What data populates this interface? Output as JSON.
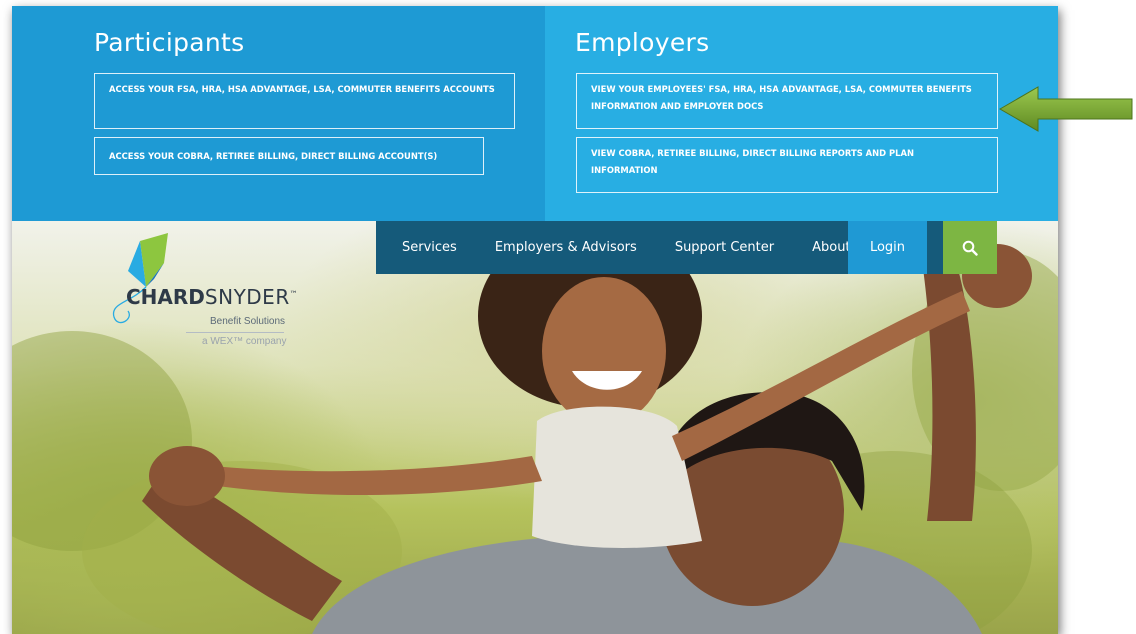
{
  "participants": {
    "title": "Participants",
    "links": [
      "ACCESS YOUR FSA, HRA, HSA ADVANTAGE, LSA, COMMUTER BENEFITS ACCOUNTS",
      "ACCESS YOUR COBRA, RETIREE BILLING, DIRECT BILLING ACCOUNT(S)"
    ]
  },
  "employers": {
    "title": "Employers",
    "links": [
      "VIEW YOUR EMPLOYEES' FSA, HRA, HSA ADVANTAGE, LSA, COMMUTER BENEFITS INFORMATION AND EMPLOYER DOCS",
      "VIEW COBRA, RETIREE BILLING, DIRECT BILLING REPORTS AND PLAN INFORMATION"
    ]
  },
  "logo": {
    "brand_bold": "CHARD",
    "brand_light": "SNYDER",
    "trademark": "™",
    "tagline": "Benefit Solutions",
    "company": "a WEX™ company"
  },
  "nav": {
    "items": [
      "Services",
      "Employers & Advisors",
      "Support Center",
      "About"
    ],
    "login": "Login",
    "search_icon": "search-icon"
  },
  "colors": {
    "participants_bg": "#1e9ad4",
    "employers_bg": "#28aee3",
    "nav_bg": "#155a7a",
    "login_bg": "#1f99d4",
    "search_bg": "#7db643",
    "annotation_arrow": "#6c9a2e"
  },
  "annotation": {
    "icon": "left-arrow-icon"
  }
}
